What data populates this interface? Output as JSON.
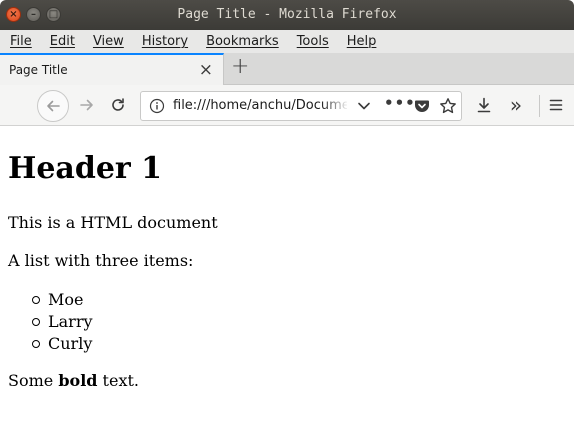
{
  "window": {
    "title": "Page Title - Mozilla Firefox",
    "close_glyph": "×",
    "minimize_glyph": "–",
    "maximize_glyph": "□"
  },
  "menubar": {
    "items": [
      "File",
      "Edit",
      "View",
      "History",
      "Bookmarks",
      "Tools",
      "Help"
    ]
  },
  "tabs": [
    {
      "label": "Page Title",
      "active": true
    }
  ],
  "tabstrip": {
    "new_tab_glyph": "+",
    "close_glyph": "×"
  },
  "navbar": {
    "url": "file:///home/anchu/Documents/",
    "more_glyph": "•••",
    "overflow_glyph": "»",
    "menu_glyph": "☰"
  },
  "page": {
    "heading": "Header 1",
    "paragraph1": "This is a HTML document",
    "paragraph2": "A list with three items:",
    "list_items": [
      "Moe",
      "Larry",
      "Curly"
    ],
    "last_before": "Some",
    "last_bold": "bold",
    "last_after": "text."
  },
  "colors": {
    "titlebar": "#3c3b37",
    "close_button": "#e95420",
    "tab_accent": "#0a84ff",
    "menubar": "#e8e8e7"
  }
}
